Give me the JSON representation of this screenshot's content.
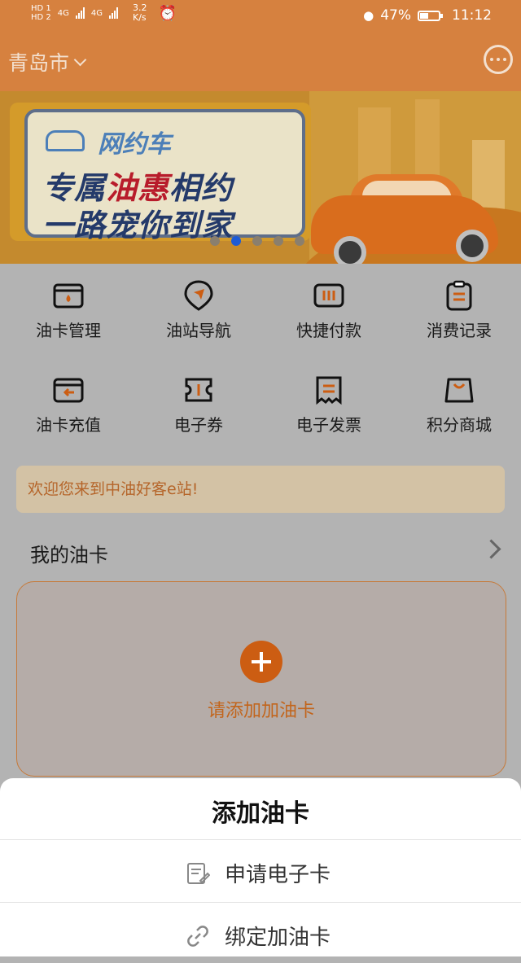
{
  "status_bar": {
    "sim1": "HD 1",
    "sim2": "HD 2",
    "net1": "4G",
    "net2": "4G",
    "speed_value": "3.2",
    "speed_unit": "K/s",
    "battery_pct": "47%",
    "battery_level": 0.47,
    "time": "11:12"
  },
  "header": {
    "city": "青岛市"
  },
  "banner": {
    "tag": "网约车",
    "line1_a": "专属",
    "line1_b": "油惠",
    "line1_c": "相约",
    "line2": "一路宠你到家",
    "slide_count": 5,
    "active_slide": 2
  },
  "menu": [
    {
      "label": "油卡管理",
      "icon": "card-drop-icon"
    },
    {
      "label": "油站导航",
      "icon": "navigation-pin-icon"
    },
    {
      "label": "快捷付款",
      "icon": "quick-pay-icon"
    },
    {
      "label": "消费记录",
      "icon": "clipboard-icon"
    },
    {
      "label": "油卡充值",
      "icon": "card-recharge-icon"
    },
    {
      "label": "电子券",
      "icon": "coupon-icon"
    },
    {
      "label": "电子发票",
      "icon": "invoice-icon"
    },
    {
      "label": "积分商城",
      "icon": "shopping-bag-icon"
    }
  ],
  "notice": "欢迎您来到中油好客e站!",
  "my_card": {
    "title": "我的油卡",
    "add_label": "请添加加油卡"
  },
  "sheet": {
    "title": "添加油卡",
    "items": [
      {
        "label": "申请电子卡",
        "icon": "e-card-icon"
      },
      {
        "label": "绑定加油卡",
        "icon": "link-icon"
      }
    ]
  },
  "colors": {
    "header_bg": "#d6813f",
    "accent": "#cc5d12",
    "notice_text": "#b5652a",
    "active_dot": "#1d5bd6"
  }
}
